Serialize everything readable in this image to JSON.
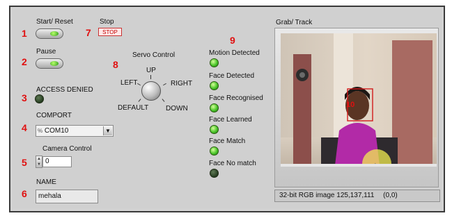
{
  "controls": {
    "start_reset": {
      "label": "Start/ Reset",
      "number": "1"
    },
    "pause": {
      "label": "Pause",
      "number": "2"
    },
    "access": {
      "label": "ACCESS DENIED",
      "number": "3"
    },
    "comport": {
      "label": "COMPORT",
      "number": "4",
      "value": "COM10",
      "prefix": "%"
    },
    "camera": {
      "label": "Camera Control",
      "number": "5",
      "value": "0"
    },
    "name": {
      "label": "NAME",
      "number": "6",
      "value": "mehala"
    },
    "stop": {
      "label": "Stop",
      "number": "7",
      "button": "STOP"
    },
    "servo": {
      "label": "Servo Control",
      "number": "8",
      "up": "UP",
      "left": "LEFT",
      "right": "RIGHT",
      "default": "DEFAULT",
      "down": "DOWN"
    },
    "indicators_number": "9"
  },
  "indicators": [
    {
      "label": "Motion Detected",
      "state": "on"
    },
    {
      "label": "Face Detected",
      "state": "on"
    },
    {
      "label": "Face Recognised",
      "state": "on"
    },
    {
      "label": "Face Learned",
      "state": "on"
    },
    {
      "label": "Face Match",
      "state": "on"
    },
    {
      "label": "Face No match",
      "state": "off"
    }
  ],
  "grab": {
    "label": "Grab/ Track",
    "status_text": "32-bit RGB image 125,137,111",
    "coords": "(0,0)",
    "face_box_label": "10"
  },
  "colors": {
    "accent": "#e01010",
    "led_on": "#4ac52a",
    "led_off": "#253c20"
  }
}
